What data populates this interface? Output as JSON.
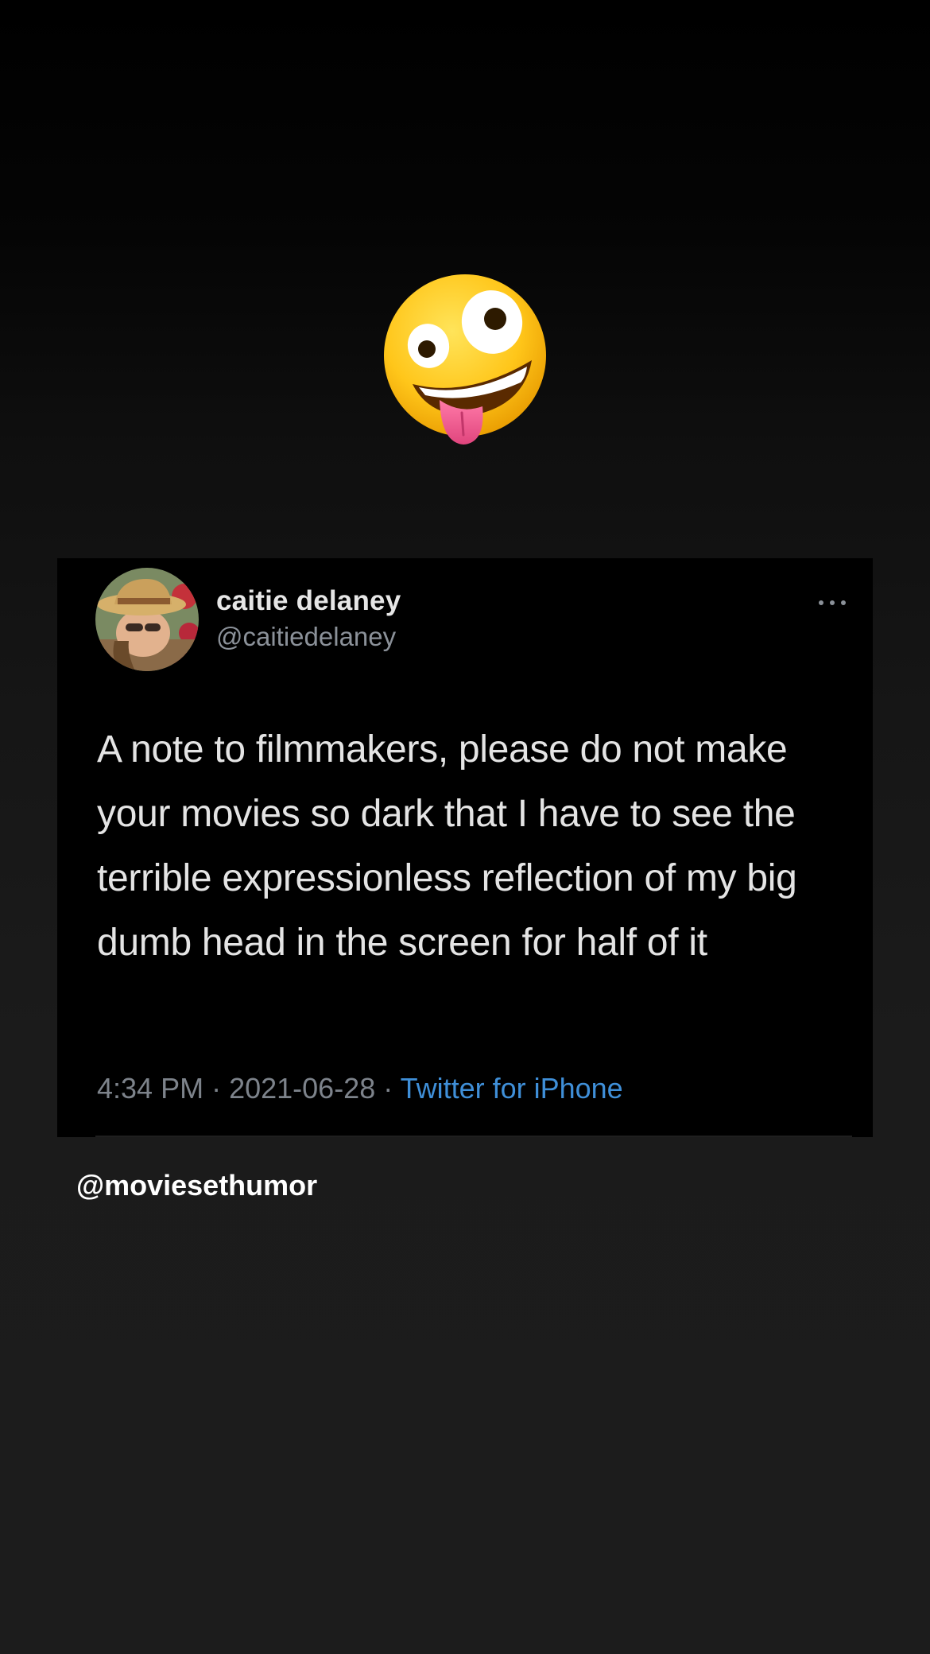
{
  "sticker": {
    "icon": "zany-face-icon"
  },
  "tweet": {
    "display_name": "caitie delaney",
    "handle": "@caitiedelaney",
    "text": "A note to filmmakers, please do not make your movies so dark that I have to see the terrible expressionless reflection of my big dumb head in the screen for half of it",
    "time": "4:34 PM",
    "date": "2021-06-28",
    "separator": " · ",
    "source": "Twitter for iPhone",
    "more_icon": "more-options-icon",
    "avatar_icon": "profile-avatar"
  },
  "credit": "@moviesethumor",
  "colors": {
    "background": "#1c1c1c",
    "card": "#000000",
    "name": "#e6e6e6",
    "muted": "#8b9199",
    "link": "#3f8fd8"
  }
}
